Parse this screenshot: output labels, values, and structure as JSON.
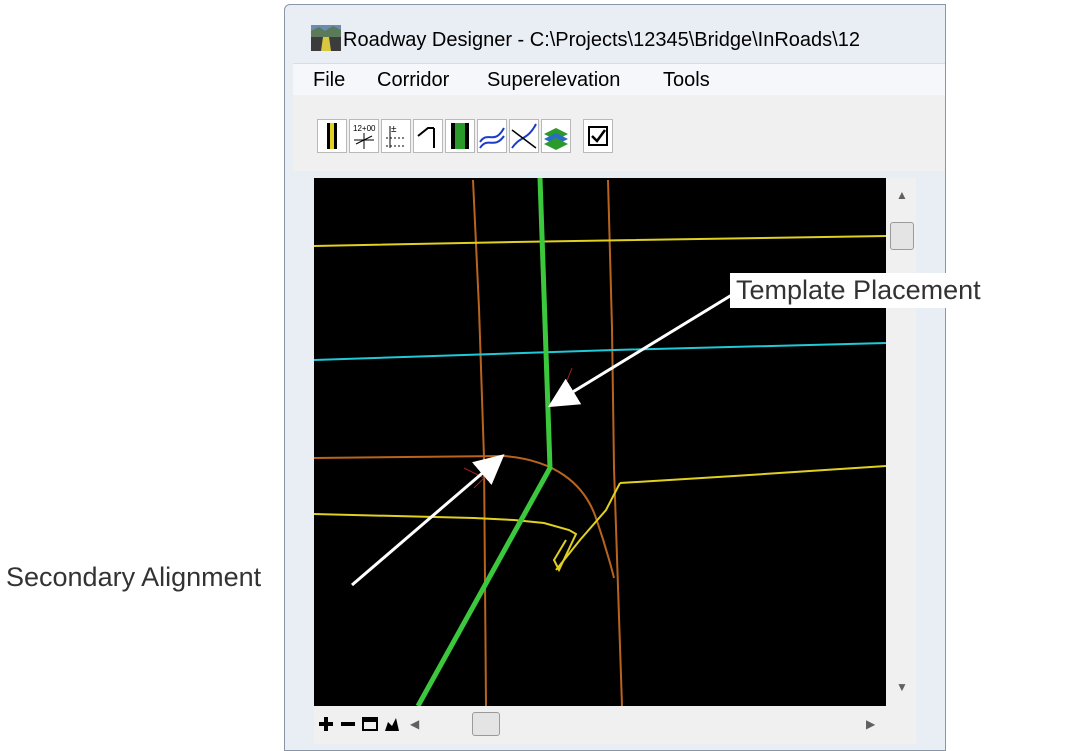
{
  "window": {
    "title": "Roadway Designer - C:\\Projects\\12345\\Bridge\\InRoads\\12"
  },
  "menu": {
    "items": [
      "File",
      "Corridor",
      "Superelevation",
      "Tools"
    ]
  },
  "toolbar": {
    "buttons": [
      {
        "icon": "corridor-management-icon"
      },
      {
        "icon": "station-lock-icon"
      },
      {
        "icon": "template-drops-icon"
      },
      {
        "icon": "point-controls-icon"
      },
      {
        "icon": "display-reference-icon"
      },
      {
        "icon": "create-surface-icon"
      },
      {
        "icon": "secondary-alignments-icon"
      },
      {
        "icon": "target-aliasing-icon"
      },
      {
        "icon": "options-checkbox-icon"
      }
    ]
  },
  "viewport": {
    "background": "#000000",
    "colors": {
      "primary_alignment": "#3cc83c",
      "edge_lines": "#e0d020",
      "curb_lines": "#b8641e",
      "cross_line": "#20c8d8"
    }
  },
  "bottom_controls": [
    "zoom-in-icon",
    "zoom-out-icon",
    "fit-view-icon",
    "pan-icon"
  ],
  "annotations": {
    "template_placement": "Template Placement",
    "secondary_alignment": "Secondary Alignment"
  }
}
